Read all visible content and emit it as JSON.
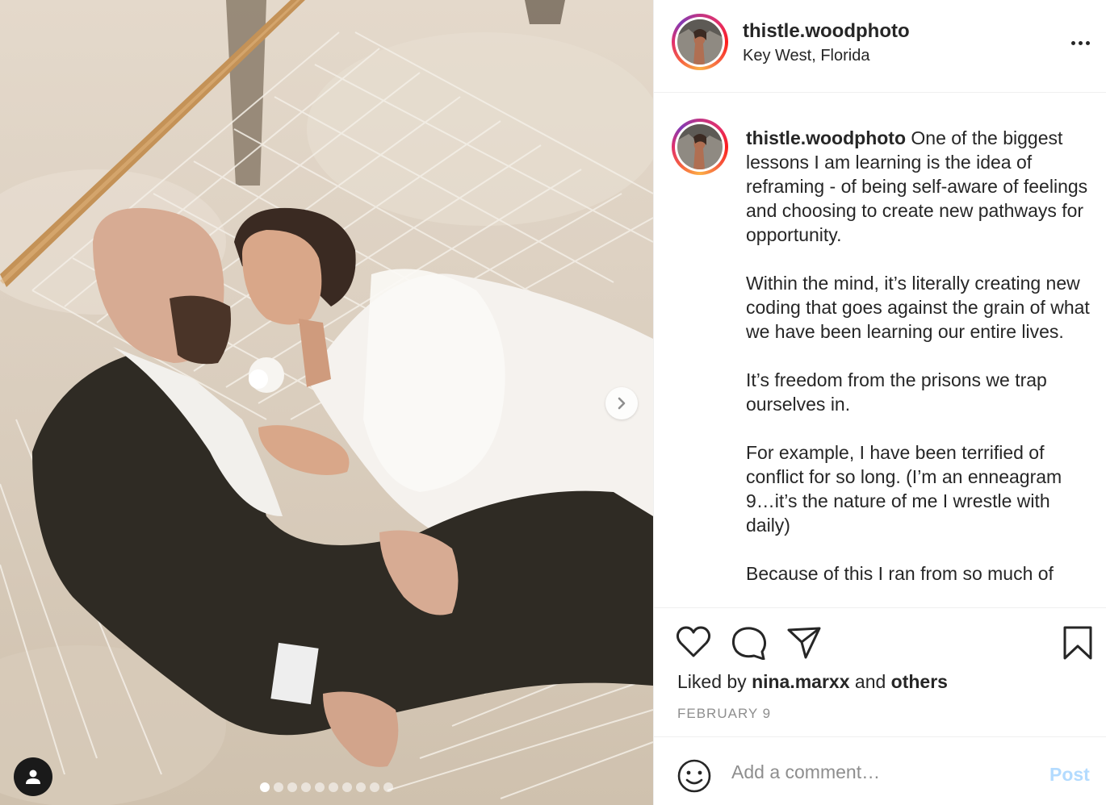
{
  "post": {
    "username": "thistle.woodphoto",
    "location": "Key West, Florida",
    "caption_paragraphs": [
      "One of the biggest lessons I am learning is the idea of reframing - of being self-aware of feelings and choosing to create new pathways for opportunity.",
      "Within the mind, it’s literally creating new coding that goes against the grain of what we have been learning our entire lives.",
      "It’s freedom from the prisons we trap ourselves in.",
      "For example, I have been terrified of conflict for so long. (I’m an enneagram 9…it’s the nature of me I wrestle with daily)",
      "Because of this I ran from so much of"
    ],
    "likes_prefix": "Liked by",
    "liked_by_user": "nina.marxx",
    "likes_joiner": "and",
    "likes_others": "others",
    "date": "FEBRUARY 9"
  },
  "comment": {
    "placeholder": "Add a comment…",
    "post_label": "Post"
  },
  "carousel": {
    "slide_count": 10,
    "active_index": 0
  },
  "colors": {
    "text": "#262626",
    "muted": "#8e8e8e",
    "post_disabled": "#b3dbff",
    "divider": "#efefef"
  },
  "icons": [
    "more-options-icon",
    "heart-icon",
    "comment-icon",
    "share-icon",
    "bookmark-icon",
    "emoji-icon",
    "chevron-right-icon",
    "user-tag-icon"
  ]
}
